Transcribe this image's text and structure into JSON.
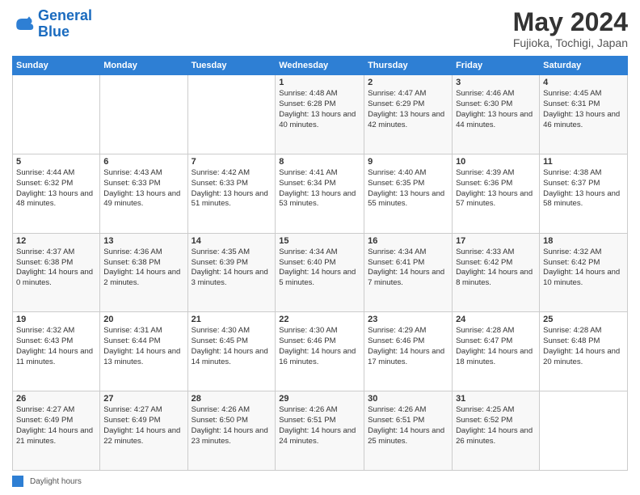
{
  "header": {
    "logo_line1": "General",
    "logo_line2": "Blue",
    "title": "May 2024",
    "subtitle": "Fujioka, Tochigi, Japan"
  },
  "days_of_week": [
    "Sunday",
    "Monday",
    "Tuesday",
    "Wednesday",
    "Thursday",
    "Friday",
    "Saturday"
  ],
  "weeks": [
    [
      {
        "num": "",
        "info": ""
      },
      {
        "num": "",
        "info": ""
      },
      {
        "num": "",
        "info": ""
      },
      {
        "num": "1",
        "info": "Sunrise: 4:48 AM\nSunset: 6:28 PM\nDaylight: 13 hours\nand 40 minutes."
      },
      {
        "num": "2",
        "info": "Sunrise: 4:47 AM\nSunset: 6:29 PM\nDaylight: 13 hours\nand 42 minutes."
      },
      {
        "num": "3",
        "info": "Sunrise: 4:46 AM\nSunset: 6:30 PM\nDaylight: 13 hours\nand 44 minutes."
      },
      {
        "num": "4",
        "info": "Sunrise: 4:45 AM\nSunset: 6:31 PM\nDaylight: 13 hours\nand 46 minutes."
      }
    ],
    [
      {
        "num": "5",
        "info": "Sunrise: 4:44 AM\nSunset: 6:32 PM\nDaylight: 13 hours\nand 48 minutes."
      },
      {
        "num": "6",
        "info": "Sunrise: 4:43 AM\nSunset: 6:33 PM\nDaylight: 13 hours\nand 49 minutes."
      },
      {
        "num": "7",
        "info": "Sunrise: 4:42 AM\nSunset: 6:33 PM\nDaylight: 13 hours\nand 51 minutes."
      },
      {
        "num": "8",
        "info": "Sunrise: 4:41 AM\nSunset: 6:34 PM\nDaylight: 13 hours\nand 53 minutes."
      },
      {
        "num": "9",
        "info": "Sunrise: 4:40 AM\nSunset: 6:35 PM\nDaylight: 13 hours\nand 55 minutes."
      },
      {
        "num": "10",
        "info": "Sunrise: 4:39 AM\nSunset: 6:36 PM\nDaylight: 13 hours\nand 57 minutes."
      },
      {
        "num": "11",
        "info": "Sunrise: 4:38 AM\nSunset: 6:37 PM\nDaylight: 13 hours\nand 58 minutes."
      }
    ],
    [
      {
        "num": "12",
        "info": "Sunrise: 4:37 AM\nSunset: 6:38 PM\nDaylight: 14 hours\nand 0 minutes."
      },
      {
        "num": "13",
        "info": "Sunrise: 4:36 AM\nSunset: 6:38 PM\nDaylight: 14 hours\nand 2 minutes."
      },
      {
        "num": "14",
        "info": "Sunrise: 4:35 AM\nSunset: 6:39 PM\nDaylight: 14 hours\nand 3 minutes."
      },
      {
        "num": "15",
        "info": "Sunrise: 4:34 AM\nSunset: 6:40 PM\nDaylight: 14 hours\nand 5 minutes."
      },
      {
        "num": "16",
        "info": "Sunrise: 4:34 AM\nSunset: 6:41 PM\nDaylight: 14 hours\nand 7 minutes."
      },
      {
        "num": "17",
        "info": "Sunrise: 4:33 AM\nSunset: 6:42 PM\nDaylight: 14 hours\nand 8 minutes."
      },
      {
        "num": "18",
        "info": "Sunrise: 4:32 AM\nSunset: 6:42 PM\nDaylight: 14 hours\nand 10 minutes."
      }
    ],
    [
      {
        "num": "19",
        "info": "Sunrise: 4:32 AM\nSunset: 6:43 PM\nDaylight: 14 hours\nand 11 minutes."
      },
      {
        "num": "20",
        "info": "Sunrise: 4:31 AM\nSunset: 6:44 PM\nDaylight: 14 hours\nand 13 minutes."
      },
      {
        "num": "21",
        "info": "Sunrise: 4:30 AM\nSunset: 6:45 PM\nDaylight: 14 hours\nand 14 minutes."
      },
      {
        "num": "22",
        "info": "Sunrise: 4:30 AM\nSunset: 6:46 PM\nDaylight: 14 hours\nand 16 minutes."
      },
      {
        "num": "23",
        "info": "Sunrise: 4:29 AM\nSunset: 6:46 PM\nDaylight: 14 hours\nand 17 minutes."
      },
      {
        "num": "24",
        "info": "Sunrise: 4:28 AM\nSunset: 6:47 PM\nDaylight: 14 hours\nand 18 minutes."
      },
      {
        "num": "25",
        "info": "Sunrise: 4:28 AM\nSunset: 6:48 PM\nDaylight: 14 hours\nand 20 minutes."
      }
    ],
    [
      {
        "num": "26",
        "info": "Sunrise: 4:27 AM\nSunset: 6:49 PM\nDaylight: 14 hours\nand 21 minutes."
      },
      {
        "num": "27",
        "info": "Sunrise: 4:27 AM\nSunset: 6:49 PM\nDaylight: 14 hours\nand 22 minutes."
      },
      {
        "num": "28",
        "info": "Sunrise: 4:26 AM\nSunset: 6:50 PM\nDaylight: 14 hours\nand 23 minutes."
      },
      {
        "num": "29",
        "info": "Sunrise: 4:26 AM\nSunset: 6:51 PM\nDaylight: 14 hours\nand 24 minutes."
      },
      {
        "num": "30",
        "info": "Sunrise: 4:26 AM\nSunset: 6:51 PM\nDaylight: 14 hours\nand 25 minutes."
      },
      {
        "num": "31",
        "info": "Sunrise: 4:25 AM\nSunset: 6:52 PM\nDaylight: 14 hours\nand 26 minutes."
      },
      {
        "num": "",
        "info": ""
      }
    ]
  ],
  "footer": {
    "daylight_label": "Daylight hours"
  }
}
